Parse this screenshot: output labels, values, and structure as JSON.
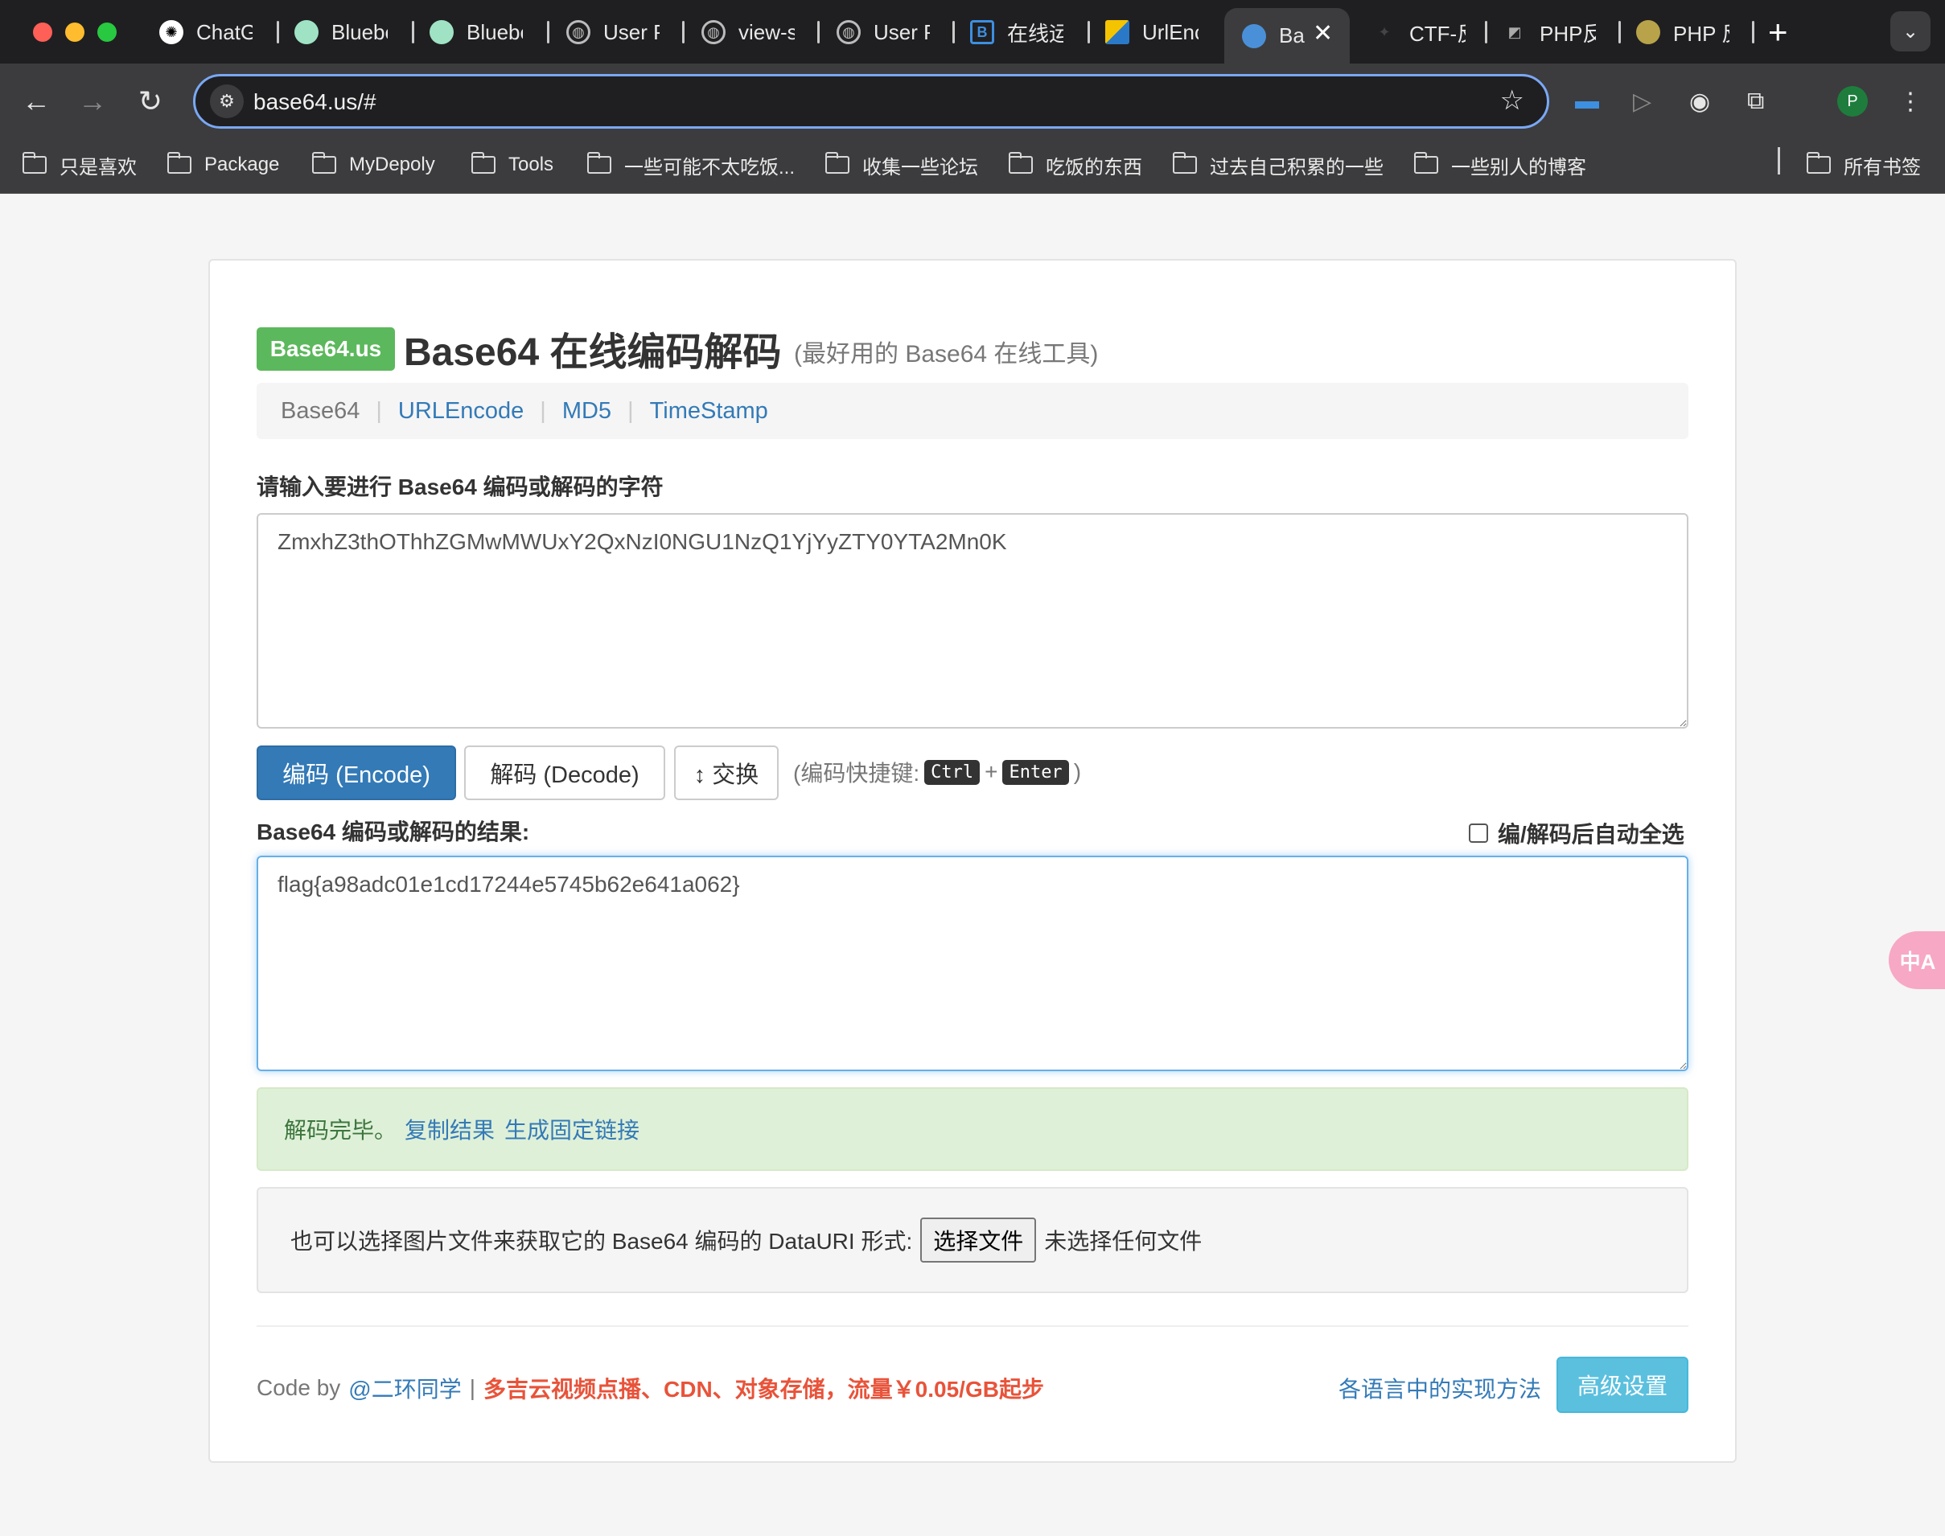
{
  "browser": {
    "tabs": [
      {
        "label": "ChatG",
        "icon": "chatgpt-icon"
      },
      {
        "label": "Bluebe",
        "icon": "bluebell-icon"
      },
      {
        "label": "Bluebe",
        "icon": "bluebell-icon"
      },
      {
        "label": "User P",
        "icon": "globe-icon"
      },
      {
        "label": "view-s",
        "icon": "globe-icon"
      },
      {
        "label": "User P",
        "icon": "globe-icon"
      },
      {
        "label": "在线运",
        "icon": "bootstrap-icon"
      },
      {
        "label": "UrlEnc",
        "icon": "urlencode-icon"
      },
      {
        "label": "Ba",
        "icon": "base64-icon",
        "active": true
      },
      {
        "label": "CTF-反",
        "icon": "ctf-icon"
      },
      {
        "label": "PHP反",
        "icon": "php-icon"
      },
      {
        "label": "PHP 反",
        "icon": "php-owl-icon"
      }
    ],
    "new_tab": "+",
    "url": "base64.us/#",
    "bookmarks": [
      "只是喜欢",
      "Package",
      "MyDepoly",
      "Tools",
      "一些可能不太吃饭...",
      "收集一些论坛",
      "吃饭的东西",
      "过去自己积累的一些",
      "一些别人的博客"
    ],
    "all_bookmarks": "所有书签",
    "profile_initial": "P"
  },
  "page": {
    "brand": "Base64.us",
    "title": "Base64 在线编码解码",
    "subtitle": "(最好用的 Base64 在线工具)",
    "nav": [
      "Base64",
      "URLEncode",
      "MD5",
      "TimeStamp"
    ],
    "input_label": "请输入要进行 Base64 编码或解码的字符",
    "input_value": "ZmxhZ3thOThhZGMwMWUxY2QxNzI0NGU1NzQ1YjYyZTY0YTA2Mn0K",
    "encode_button": "编码 (Encode)",
    "decode_button": "解码 (Decode)",
    "swap_button": "↕ 交换",
    "shortcut_prefix": "(编码快捷键:",
    "shortcut_key1": "Ctrl",
    "shortcut_plus": "+",
    "shortcut_key2": "Enter",
    "shortcut_suffix": ")",
    "result_label": "Base64 编码或解码的结果:",
    "auto_select_label": "编/解码后自动全选",
    "result_value": "flag{a98adc01e1cd17244e5745b62e641a062}",
    "status_message": "解码完毕。",
    "copy_link": "复制结果",
    "permalink": "生成固定链接",
    "file_prompt": "也可以选择图片文件来获取它的 Base64 编码的 DataURI 形式:",
    "file_button": "选择文件",
    "file_status": "未选择任何文件",
    "footer_code_by": "Code by",
    "footer_author": "@二环同学",
    "footer_separator": "|",
    "footer_promo": "多吉云视频点播、CDN、对象存储，流量￥0.05/GB起步",
    "footer_impl_link": "各语言中的实现方法",
    "advanced_button": "高级设置",
    "translate_widget": "中A"
  },
  "colors": {
    "brand_green": "#5cb85c",
    "primary_blue": "#337ab7",
    "info_blue": "#5bc0de",
    "success_bg": "#dff0d8",
    "promo_red": "#e8533a"
  }
}
